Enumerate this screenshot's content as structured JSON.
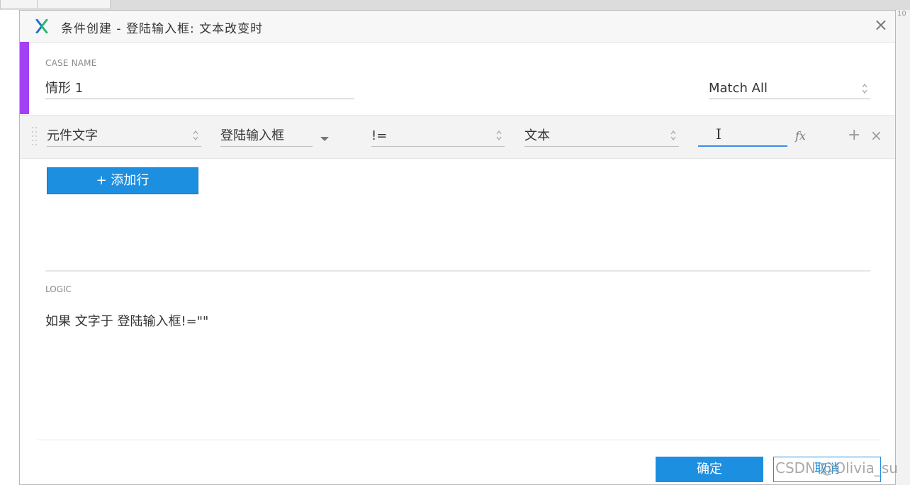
{
  "background": {
    "tabs": [
      "",
      ""
    ],
    "ruler_number": "10"
  },
  "dialog": {
    "title": "条件创建 - 登陆输入框: 文本改变时",
    "case": {
      "label": "CASE NAME",
      "name": "情形 1",
      "match": "Match All"
    },
    "condition": {
      "target_type": "元件文字",
      "target": "登陆输入框",
      "operator": "!=",
      "value_type": "文本",
      "value": ""
    },
    "add_row_label": "+ 添加行",
    "logic": {
      "label": "LOGIC",
      "text": "如果 文字于 登陆输入框!=\"\""
    },
    "ok_label": "确定",
    "cancel_label": "取消"
  },
  "watermark": "CSDN @Olivia_su",
  "colors": {
    "accent": "#1d8fe1",
    "purple": "#a340f4"
  },
  "icons": {
    "app": "axure-x-icon",
    "close": "close-icon",
    "fx": "fx-icon",
    "add": "plus-icon",
    "remove": "close-icon"
  }
}
